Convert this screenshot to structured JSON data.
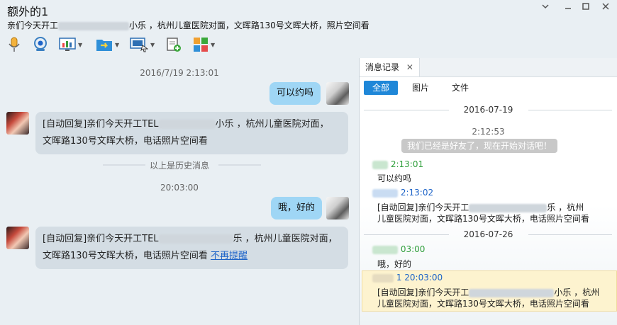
{
  "window": {
    "title": "额外的1",
    "signature_start": "亲们今天开工",
    "signature_end": "小乐 ，杭州儿童医院对面，文晖路130号文晖大桥，照片空间看",
    "controls": [
      "minimize-menu",
      "minimize",
      "maximize",
      "close"
    ]
  },
  "toolbar": {
    "icons": [
      "microphone-icon",
      "camera-icon",
      "screen-share-icon",
      "file-transfer-icon",
      "remote-desktop-icon",
      "note-add-icon",
      "apps-icon"
    ]
  },
  "chat": {
    "messages": [
      {
        "type": "time",
        "text": "2016/7/19 2:13:01"
      },
      {
        "type": "out",
        "text": "可以约吗"
      },
      {
        "type": "in",
        "line1_start": "[自动回复]亲们今天开工TEL",
        "line1_end": "小乐 ，杭州儿童医院对面，",
        "line2": "文晖路130号文晖大桥，电话照片空间看"
      },
      {
        "type": "divider",
        "text": "以上是历史消息"
      },
      {
        "type": "time",
        "text": "20:03:00"
      },
      {
        "type": "out",
        "text": "哦，好的"
      },
      {
        "type": "in",
        "line1_start": "[自动回复]亲们今天开工TEL",
        "line1_end": "乐 ，杭州儿童医院对面，",
        "line2": "文晖路130号文晖大桥，电话照片空间看",
        "link": "不再提醒"
      }
    ]
  },
  "history": {
    "tab_label": "消息记录",
    "filters": [
      "全部",
      "图片",
      "文件"
    ],
    "date1": "2016-07-19",
    "time1": "2:12:53",
    "system_msg": "我们已经是好友了，现在开始对话吧！",
    "entries": [
      {
        "name_time": "2:13:01",
        "text": "可以约吗",
        "color": "green"
      },
      {
        "name_time": "2:13:02",
        "line1_start": "[自动回复]亲们今天开工",
        "line1_end": "乐 ，杭州",
        "line2": "儿童医院对面，文晖路130号文晖大桥，电话照片空间看",
        "color": "blue"
      }
    ],
    "date2": "2016-07-26",
    "entries2": [
      {
        "name_time": "03:00",
        "text": "哦，好的",
        "color": "green"
      },
      {
        "name_time": "1 20:03:00",
        "line1_start": "[自动回复]亲们今天开工",
        "line1_end": "小乐 ，杭州",
        "line2": "儿童医院对面，文晖路130号文晖大桥，电话照片空间看",
        "color": "blue"
      }
    ]
  },
  "colors": {
    "accent": "#1f87d8",
    "bubble_out": "#9fd6f5",
    "bubble_in": "#d4dde4"
  }
}
